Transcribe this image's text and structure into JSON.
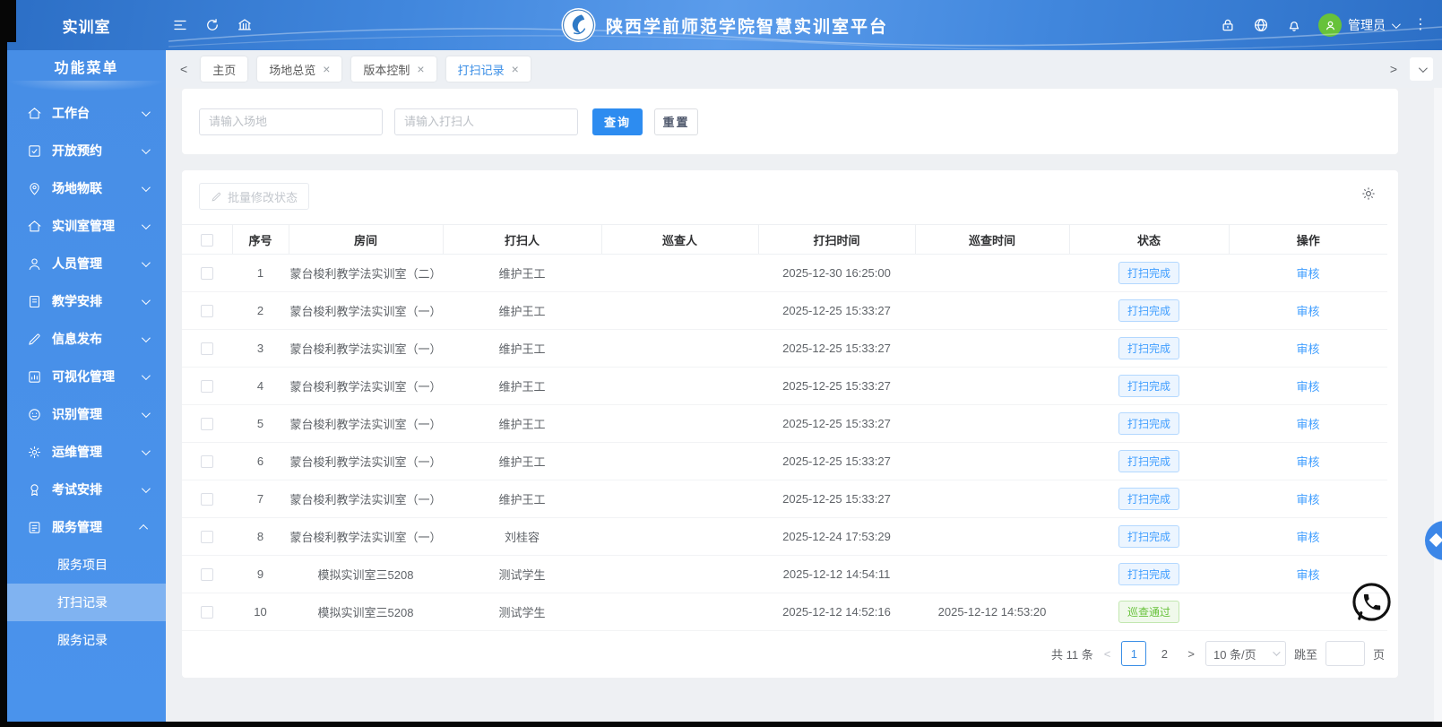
{
  "app": {
    "brand": "实训室",
    "title": "陕西学前师范学院智慧实训室平台"
  },
  "header": {
    "left_icons": [
      "collapse-menu-icon",
      "refresh-icon",
      "bank-icon"
    ],
    "right_icons": [
      "lock-icon",
      "globe-icon",
      "bell-icon"
    ],
    "user": {
      "name": "管理员"
    }
  },
  "sidebar": {
    "title": "功能菜单",
    "items": [
      {
        "label": "工作台",
        "icon": "home-icon",
        "expanded": false
      },
      {
        "label": "开放预约",
        "icon": "check-square-icon",
        "expanded": false
      },
      {
        "label": "场地物联",
        "icon": "map-pin-icon",
        "expanded": false
      },
      {
        "label": "实训室管理",
        "icon": "home-icon",
        "expanded": false
      },
      {
        "label": "人员管理",
        "icon": "user-icon",
        "expanded": false
      },
      {
        "label": "教学安排",
        "icon": "schedule-icon",
        "expanded": false
      },
      {
        "label": "信息发布",
        "icon": "pencil-icon",
        "expanded": false
      },
      {
        "label": "可视化管理",
        "icon": "chart-icon",
        "expanded": false
      },
      {
        "label": "识别管理",
        "icon": "face-icon",
        "expanded": false
      },
      {
        "label": "运维管理",
        "icon": "gear-icon",
        "expanded": false
      },
      {
        "label": "考试安排",
        "icon": "award-icon",
        "expanded": false
      },
      {
        "label": "服务管理",
        "icon": "service-doc-icon",
        "expanded": true
      }
    ],
    "subitems": [
      {
        "label": "服务项目",
        "active": false
      },
      {
        "label": "打扫记录",
        "active": true
      },
      {
        "label": "服务记录",
        "active": false
      }
    ]
  },
  "tabs": [
    {
      "label": "主页",
      "closable": false,
      "active": false
    },
    {
      "label": "场地总览",
      "closable": true,
      "active": false
    },
    {
      "label": "版本控制",
      "closable": true,
      "active": false
    },
    {
      "label": "打扫记录",
      "closable": true,
      "active": true
    }
  ],
  "search": {
    "site_placeholder": "请输入场地",
    "cleaner_placeholder": "请输入打扫人",
    "query_label": "查询",
    "reset_label": "重置"
  },
  "toolbar": {
    "batch_label": "批量修改状态"
  },
  "table": {
    "columns": [
      "序号",
      "房间",
      "打扫人",
      "巡查人",
      "打扫时间",
      "巡查时间",
      "状态",
      "操作"
    ],
    "rows": [
      {
        "no": "1",
        "room": "蒙台梭利教学法实训室（二）",
        "cleaner": "维护王工",
        "inspector": "",
        "clean_time": "2025-12-30 16:25:00",
        "inspect_time": "",
        "status": "打扫完成",
        "status_type": "info",
        "action": "审核"
      },
      {
        "no": "2",
        "room": "蒙台梭利教学法实训室（一）",
        "cleaner": "维护王工",
        "inspector": "",
        "clean_time": "2025-12-25 15:33:27",
        "inspect_time": "",
        "status": "打扫完成",
        "status_type": "info",
        "action": "审核"
      },
      {
        "no": "3",
        "room": "蒙台梭利教学法实训室（一）",
        "cleaner": "维护王工",
        "inspector": "",
        "clean_time": "2025-12-25 15:33:27",
        "inspect_time": "",
        "status": "打扫完成",
        "status_type": "info",
        "action": "审核"
      },
      {
        "no": "4",
        "room": "蒙台梭利教学法实训室（一）",
        "cleaner": "维护王工",
        "inspector": "",
        "clean_time": "2025-12-25 15:33:27",
        "inspect_time": "",
        "status": "打扫完成",
        "status_type": "info",
        "action": "审核"
      },
      {
        "no": "5",
        "room": "蒙台梭利教学法实训室（一）",
        "cleaner": "维护王工",
        "inspector": "",
        "clean_time": "2025-12-25 15:33:27",
        "inspect_time": "",
        "status": "打扫完成",
        "status_type": "info",
        "action": "审核"
      },
      {
        "no": "6",
        "room": "蒙台梭利教学法实训室（一）",
        "cleaner": "维护王工",
        "inspector": "",
        "clean_time": "2025-12-25 15:33:27",
        "inspect_time": "",
        "status": "打扫完成",
        "status_type": "info",
        "action": "审核"
      },
      {
        "no": "7",
        "room": "蒙台梭利教学法实训室（一）",
        "cleaner": "维护王工",
        "inspector": "",
        "clean_time": "2025-12-25 15:33:27",
        "inspect_time": "",
        "status": "打扫完成",
        "status_type": "info",
        "action": "审核"
      },
      {
        "no": "8",
        "room": "蒙台梭利教学法实训室（一）",
        "cleaner": "刘桂容",
        "inspector": "",
        "clean_time": "2025-12-24 17:53:29",
        "inspect_time": "",
        "status": "打扫完成",
        "status_type": "info",
        "action": "审核"
      },
      {
        "no": "9",
        "room": "模拟实训室三5208",
        "cleaner": "测试学生",
        "inspector": "",
        "clean_time": "2025-12-12 14:54:11",
        "inspect_time": "",
        "status": "打扫完成",
        "status_type": "info",
        "action": "审核"
      },
      {
        "no": "10",
        "room": "模拟实训室三5208",
        "cleaner": "测试学生",
        "inspector": "",
        "clean_time": "2025-12-12 14:52:16",
        "inspect_time": "2025-12-12 14:53:20",
        "status": "巡查通过",
        "status_type": "success",
        "action": ""
      }
    ]
  },
  "pagination": {
    "total_label": "共 11 条",
    "pages": [
      "1",
      "2"
    ],
    "current_page": "1",
    "page_size_label": "10 条/页",
    "jump_label": "跳至",
    "page_unit_label": "页"
  },
  "colors": {
    "header_blue": "#4187dd",
    "sidebar_blue": "#4a93ec",
    "primary": "#2d8cf0",
    "link": "#409eff",
    "status_info_text": "#409eff",
    "status_info_bg": "#ecf5ff",
    "status_success_text": "#67c23a",
    "status_success_bg": "#f0f9eb"
  }
}
